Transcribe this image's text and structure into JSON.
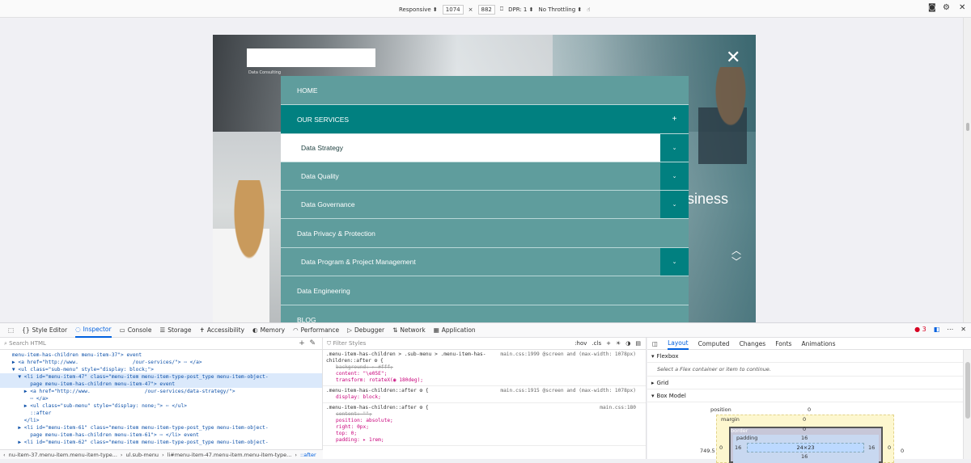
{
  "rdm": {
    "device": "Responsive ⬍",
    "width": "1074",
    "times": "×",
    "height": "882",
    "dpr": "DPR: 1 ⬍",
    "throttle": "No Throttling ⬍"
  },
  "site": {
    "tagline": "Data Consulting",
    "hero_text": "siness",
    "menu": [
      {
        "label": "HOME",
        "kind": "top",
        "toggle": ""
      },
      {
        "label": "OUR SERVICES",
        "kind": "active",
        "toggle": "+"
      },
      {
        "label": "Data Strategy",
        "kind": "white",
        "toggle": "⌄"
      },
      {
        "label": "Data Quality",
        "kind": "sub",
        "toggle": "⌄"
      },
      {
        "label": "Data Governance",
        "kind": "sub",
        "toggle": "⌄"
      },
      {
        "label": "Data Privacy & Protection",
        "kind": "top",
        "toggle": ""
      },
      {
        "label": "Data Program & Project Management",
        "kind": "sub",
        "toggle": "⌄"
      },
      {
        "label": "Data Engineering",
        "kind": "top",
        "toggle": ""
      },
      {
        "label": "BLOG",
        "kind": "top",
        "toggle": ""
      }
    ]
  },
  "devtools": {
    "tabs": [
      "Style Editor",
      "Inspector",
      "Console",
      "Storage",
      "Accessibility",
      "Memory",
      "Performance",
      "Debugger",
      "Network",
      "Application"
    ],
    "error_count": "3",
    "search_placeholder": "Search HTML",
    "filter_placeholder": "Filter Styles",
    "filter_tools": [
      ":hov",
      ".cls",
      "+"
    ],
    "html_lines": [
      "    menu-item-has-children menu-item-37\"> event",
      "    ▶ <a href=\"http://www.                  /our-services/\"> ⋯ </a>",
      "    ▼ <ul class=\"sub-menu\" style=\"display: block;\">",
      "      ▼ <li id=\"menu-item-47\" class=\"menu-item menu-item-type-post_type menu-item-object-",
      "          page menu-item-has-children menu-item-47\"> event",
      "        ▶ <a href=\"http://www.                  /our-services/data-strategy/\">",
      "          ⋯ </a>",
      "        ▶ <ul class=\"sub-menu\" style=\"display: none;\"> ⋯ </ul>",
      "          ::after",
      "        </li>",
      "      ▶ <li id=\"menu-item-61\" class=\"menu-item menu-item-type-post_type menu-item-object-",
      "          page menu-item-has-children menu-item-61\"> ⋯ </li> event",
      "      ▶ <li id=\"menu-item-62\" class=\"menu-item menu-item-type-post_type menu-item-object-"
    ],
    "breadcrumbs": [
      "nu-item-37.menu-item.menu-item-type...",
      "ul.sub-menu",
      "li#menu-item-47.menu-item.menu-item-type...",
      "::after"
    ],
    "rules": [
      {
        "selector": ".menu-item-has-children > .sub-menu > .menu-item-has-children::after ⚙ {",
        "source": "main.css:1999 @screen and (max-width: 1078px)",
        "props": [
          [
            "background: ▸ #fff;",
            true
          ],
          [
            "content: \"\\e05E\";",
            false
          ],
          [
            "transform: rotateX(◉ 180deg);",
            false
          ]
        ]
      },
      {
        "selector": ".menu-item-has-children::after ⚙ {",
        "source": "main.css:1915 @screen and (max-width: 1078px)",
        "props": [
          [
            "display: block;",
            false
          ]
        ]
      },
      {
        "selector": ".menu-item-has-children::after ⚙ {",
        "source": "main.css:180",
        "props": [
          [
            "content: \"\";",
            true
          ],
          [
            "position: absolute;",
            false
          ],
          [
            "right: 0px;",
            false
          ],
          [
            "top: 0;",
            false
          ],
          [
            "padding: ▸ 1rem;",
            false
          ]
        ]
      }
    ],
    "layout_tabs": [
      "Layout",
      "Computed",
      "Changes",
      "Fonts",
      "Animations"
    ],
    "flexbox_title": "Flexbox",
    "flexbox_hint": "Select a Flex container or item to continue.",
    "grid_title": "Grid",
    "boxmodel_title": "Box Model",
    "boxmodel": {
      "position": "position",
      "position_val": "0",
      "margin": "margin",
      "margin_val": "0",
      "border": "border",
      "border_val": "0",
      "padding": "padding",
      "padding_val": "16",
      "content": "24×23",
      "side_left": "16",
      "side_right": "16",
      "outer_left": "0",
      "outer_right": "0",
      "left_offset": "749.5",
      "bottom": "16"
    }
  }
}
